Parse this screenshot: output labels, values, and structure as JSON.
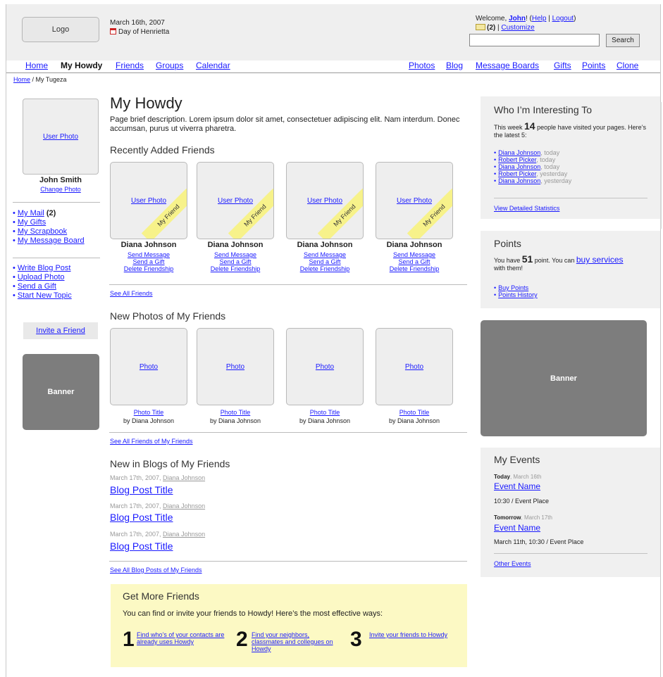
{
  "header": {
    "logo": "Logo",
    "date": "March 16th, 2007",
    "day_of": "Day of Henrietta",
    "welcome_prefix": "Welcome, ",
    "user": "John",
    "help": "Help",
    "logout": "Logout",
    "mail_count": "(2)",
    "customize": "Customize",
    "search_value": "",
    "search_button": "Search"
  },
  "nav": {
    "left": [
      "Home",
      "My Howdy",
      "Friends",
      "Groups",
      "Calendar"
    ],
    "active": "My Howdy",
    "right": [
      "Photos",
      "Blog",
      "Message Boards",
      "Gifts",
      "Points",
      "Clone"
    ]
  },
  "breadcrumb": {
    "home": "Home",
    "current": "My Tugeza"
  },
  "left": {
    "user_photo": "User Photo",
    "name": "John Smith",
    "change_photo": "Change Photo",
    "menu1": [
      "My Mail",
      "My Gifts",
      "My Scrapbook",
      "My Message Board"
    ],
    "mail_count": "(2)",
    "menu2": [
      "Write Blog Post",
      "Upload Photo",
      "Send a Gift",
      "Start New Topic"
    ],
    "invite": "Invite a Friend",
    "banner": "Banner"
  },
  "main": {
    "title": "My Howdy",
    "description": "Page brief description. Lorem ipsum dolor sit amet, consectetuer adipiscing elit. Nam interdum. Donec accumsan, purus ut viverra pharetra.",
    "recent_friends": {
      "heading": "Recently Added Friends",
      "friends": [
        {
          "photo": "User Photo",
          "badge": "My Friend",
          "name": "Diana Johnson",
          "send_message": "Send Message",
          "send_gift": "Send a Gift",
          "delete": "Delete Friendship"
        },
        {
          "photo": "User Photo",
          "badge": "My Friend",
          "name": "Diana Johnson",
          "send_message": "Send Message",
          "send_gift": "Send a Gift",
          "delete": "Delete Friendship"
        },
        {
          "photo": "User Photo",
          "badge": "My Friend",
          "name": "Diana Johnson",
          "send_message": "Send Message",
          "send_gift": "Send a Gift",
          "delete": "Delete Friendship"
        },
        {
          "photo": "User Photo",
          "badge": "My Friend",
          "name": "Diana Johnson",
          "send_message": "Send Message",
          "send_gift": "Send a Gift",
          "delete": "Delete Friendship"
        }
      ],
      "see_all": "See All Friends"
    },
    "new_photos": {
      "heading": "New Photos of My Friends",
      "photos": [
        {
          "photo": "Photo",
          "title": "Photo Title",
          "by": "by Diana Johnson"
        },
        {
          "photo": "Photo",
          "title": "Photo Title",
          "by": "by Diana Johnson"
        },
        {
          "photo": "Photo",
          "title": "Photo Title",
          "by": "by Diana Johnson"
        },
        {
          "photo": "Photo",
          "title": "Photo Title",
          "by": "by Diana Johnson"
        }
      ],
      "see_all": "See All Friends of My Friends"
    },
    "blogs": {
      "heading": "New in Blogs of My Friends",
      "posts": [
        {
          "date": "March 17th, 2007, ",
          "author": "Diana Johnson",
          "title": "Blog Post Title"
        },
        {
          "date": "March 17th, 2007, ",
          "author": "Diana Johnson",
          "title": "Blog Post Title"
        },
        {
          "date": "March 17th, 2007, ",
          "author": "Diana Johnson",
          "title": "Blog Post Title"
        }
      ],
      "see_all": "See All Blog Posts of My Friends"
    },
    "get_more": {
      "title": "Get More Friends",
      "text": "You can find or invite your friends to Howdy! Here’s the most effective ways:",
      "ways": [
        {
          "num": "1",
          "text": "Find who’s of your contacts are already uses Howdy"
        },
        {
          "num": "2",
          "text": "Find your neighbors, classmates and collegues on Howdy"
        },
        {
          "num": "3",
          "text": "Invite your friends to Howdy"
        }
      ]
    }
  },
  "right": {
    "interesting": {
      "title": "Who I’m Interesting To",
      "text_a": "This week ",
      "count": "14",
      "text_b": " people have visited your pages. Here’s the latest 5:",
      "visitors": [
        {
          "name": "Diana Johnson",
          "when": ", today"
        },
        {
          "name": "Robert Picker",
          "when": ", today"
        },
        {
          "name": "Diana Johnson",
          "when": ", today"
        },
        {
          "name": "Robert Picker",
          "when": ", yesterday"
        },
        {
          "name": "Diana Johnson",
          "when": ", yesterday"
        }
      ],
      "stats_link": "View Detailed Statistics"
    },
    "points": {
      "title": "Points",
      "text_a": "You have ",
      "count": "51",
      "text_b": " point. You can ",
      "buy_link": "buy services",
      "text_c": "with them!",
      "links": [
        "Buy Points",
        "Points History"
      ]
    },
    "banner": "Banner",
    "events": {
      "title": "My Events",
      "today_label": "Today",
      "today_date": ", March 16th",
      "event1_name": "Event Name",
      "event1_detail": "10:30 / Event Place",
      "tomorrow_label": "Tomorrow",
      "tomorrow_date": ", March 17th",
      "event2_name": "Event Name",
      "event2_detail": "March 11th, 10:30 / Event Place",
      "other": "Other Events"
    }
  }
}
